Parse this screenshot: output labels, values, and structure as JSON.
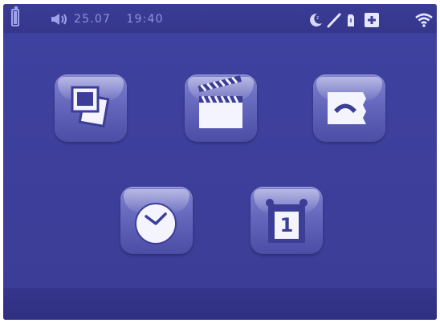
{
  "status_bar": {
    "date": "25.07",
    "time": "19:40",
    "icons": [
      "battery-icon",
      "speaker-icon",
      "night-mode-icon",
      "pen-icon",
      "doorbell-icon",
      "plus-icon",
      "wifi-icon"
    ]
  },
  "apps": [
    {
      "name": "photos",
      "icon": "photos-icon"
    },
    {
      "name": "video",
      "icon": "clapperboard-icon"
    },
    {
      "name": "intercom",
      "icon": "phone-icon"
    },
    {
      "name": "alarm",
      "icon": "clock-icon"
    },
    {
      "name": "calendar",
      "icon": "calendar-icon",
      "day": "1"
    }
  ],
  "colors": {
    "background": "#3e3f9a",
    "tile": "#6567bd",
    "status_text": "#8f92df"
  }
}
